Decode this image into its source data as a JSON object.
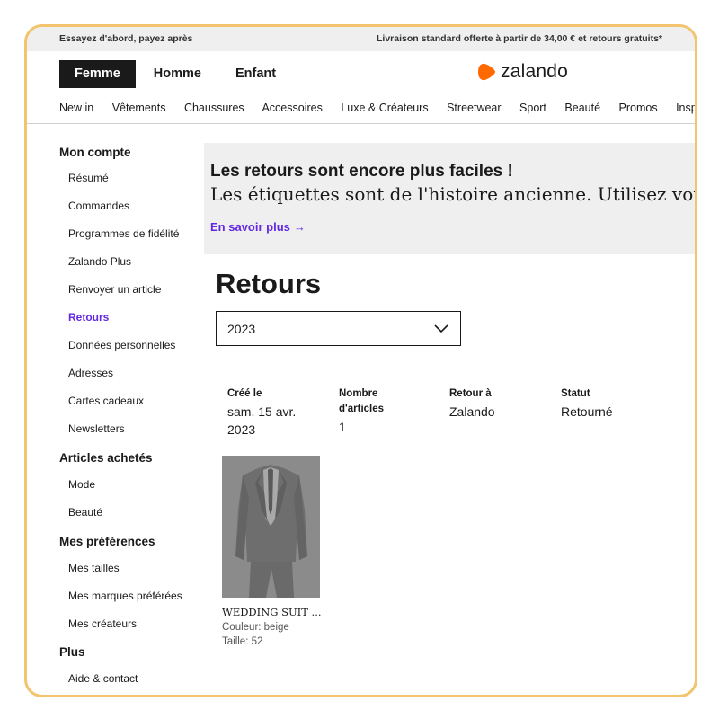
{
  "topbar": {
    "left_text": "Essayez d'abord, payez après",
    "right_text": "Livraison standard offerte à partir de 34,00 € et retours gratuits*"
  },
  "gender_tabs": [
    {
      "label": "Femme",
      "active": true
    },
    {
      "label": "Homme",
      "active": false
    },
    {
      "label": "Enfant",
      "active": false
    }
  ],
  "brand": {
    "name": "zalando",
    "accent_color": "#ff6900",
    "icon": "zalando-logo-icon"
  },
  "category_nav": [
    "New in",
    "Vêtements",
    "Chaussures",
    "Accessoires",
    "Luxe & Créateurs",
    "Streetwear",
    "Sport",
    "Beauté",
    "Promos",
    "Inspirat"
  ],
  "sidebar": {
    "sections": [
      {
        "title": "Mon compte",
        "items": [
          "Résumé",
          "Commandes",
          "Programmes de fidélité",
          "Zalando Plus",
          "Renvoyer un article",
          "Retours",
          "Données personnelles",
          "Adresses",
          "Cartes cadeaux",
          "Newsletters"
        ]
      },
      {
        "title": "Articles achetés",
        "items": [
          "Mode",
          "Beauté"
        ]
      },
      {
        "title": "Mes préférences",
        "items": [
          "Mes tailles",
          "Mes marques préférées",
          "Mes créateurs"
        ]
      },
      {
        "title": "Plus",
        "items": [
          "Aide & contact"
        ]
      }
    ],
    "active_item": "Retours",
    "active_color": "#6328e0"
  },
  "banner": {
    "title": "Les retours sont encore plus faciles !",
    "subtitle": "Les étiquettes sont de l'histoire ancienne. Utilisez votre po",
    "link": "En savoir plus",
    "link_icon": "arrow-right-icon"
  },
  "page_title": "Retours",
  "year_select": {
    "value": "2023",
    "icon": "chevron-down-icon"
  },
  "return_info": {
    "columns": [
      {
        "header": "Créé le",
        "value": "sam. 15 avr. 2023"
      },
      {
        "header": "Nombre d'articles",
        "value": "1"
      },
      {
        "header": "Retour à",
        "value": "Zalando"
      },
      {
        "header": "Statut",
        "value": "Retourné"
      }
    ]
  },
  "product": {
    "name": "WEDDING SUIT ...",
    "color": "Couleur: beige",
    "size": "Taille: 52",
    "image_icon": "suit-image"
  }
}
